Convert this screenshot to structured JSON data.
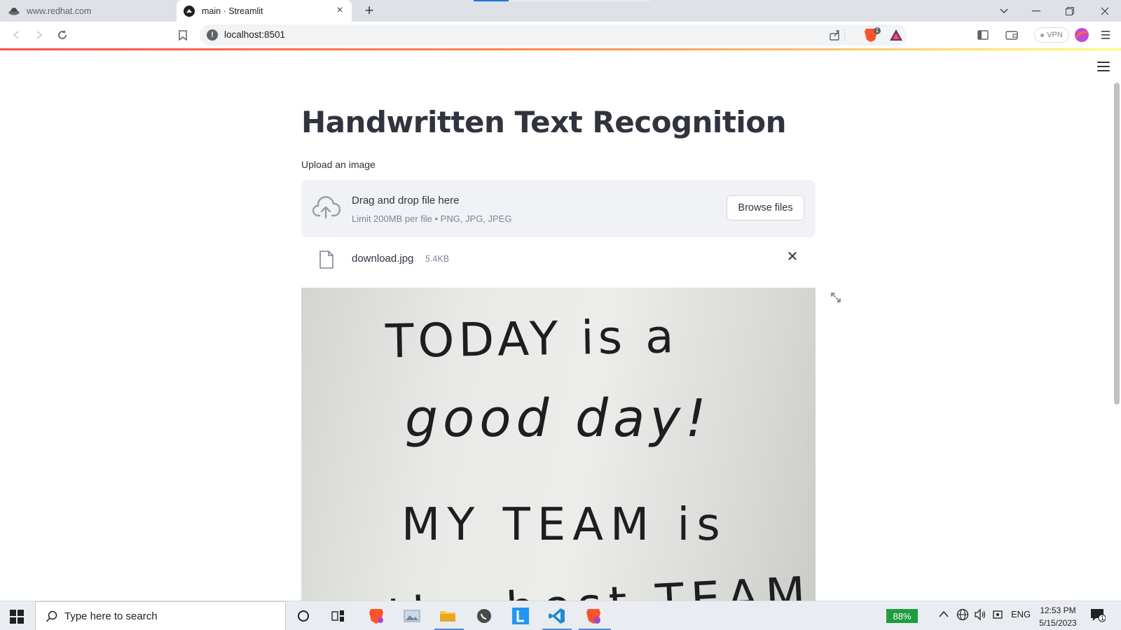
{
  "browser": {
    "tabs": [
      {
        "title": "www.redhat.com",
        "active": false
      },
      {
        "title": "main · Streamlit",
        "active": true
      }
    ],
    "url": "localhost:8501",
    "vpn_label": "VPN",
    "brave_badge": "1"
  },
  "app": {
    "title": "Handwritten Text Recognition",
    "uploader": {
      "label": "Upload an image",
      "drag_text": "Drag and drop file here",
      "limit_text": "Limit 200MB per file • PNG, JPG, JPEG",
      "browse_label": "Browse files"
    },
    "file": {
      "name": "download.jpg",
      "size": "5.4KB"
    },
    "image_lines": [
      "TODAY is a",
      "good day!",
      "MY TEAM is",
      "the best TEAM!"
    ]
  },
  "taskbar": {
    "search_placeholder": "Type here to search",
    "battery": "88%",
    "language": "ENG",
    "time": "12:53 PM",
    "date": "5/15/2023",
    "notifications": "1"
  }
}
